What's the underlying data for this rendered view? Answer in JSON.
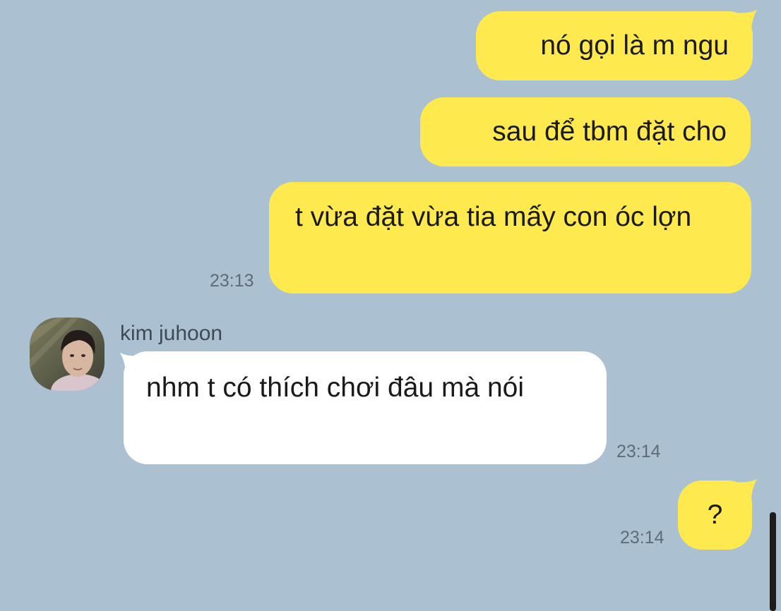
{
  "colors": {
    "background": "#abc1d1",
    "outgoing_bubble": "#fee94f",
    "incoming_bubble": "#ffffff",
    "timestamp": "#5e6c78"
  },
  "messages": [
    {
      "direction": "out",
      "text": "nó gọi là m ngu"
    },
    {
      "direction": "out",
      "text": "sau để tbm đặt cho"
    },
    {
      "direction": "out",
      "text": "t vừa đặt vừa tia mấy con óc lợn",
      "time": "23:13"
    },
    {
      "direction": "in",
      "sender": "kim juhoon",
      "avatar_icon": "profile-photo",
      "text": "nhm t có thích chơi đâu mà nói",
      "time": "23:14"
    },
    {
      "direction": "out",
      "text": "?",
      "time": "23:14"
    }
  ]
}
